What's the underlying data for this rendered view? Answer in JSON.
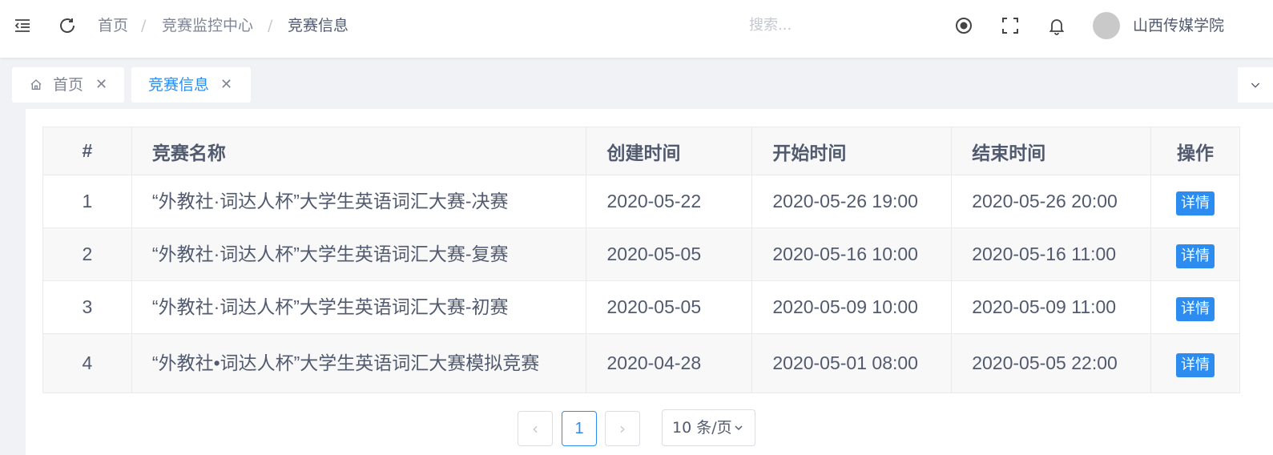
{
  "header": {
    "breadcrumb": [
      "首页",
      "竞赛监控中心",
      "竞赛信息"
    ],
    "breadcrumb_sep": "/",
    "search_placeholder": "搜索...",
    "user_name": "山西传媒学院"
  },
  "tabs": [
    {
      "label": "首页",
      "active": false
    },
    {
      "label": "竞赛信息",
      "active": true
    }
  ],
  "table": {
    "headers": [
      "#",
      "竞赛名称",
      "创建时间",
      "开始时间",
      "结束时间",
      "操作"
    ],
    "rows": [
      {
        "index": "1",
        "name": "“外教社·词达人杯”大学生英语词汇大赛-决赛",
        "created": "2020-05-22",
        "start": "2020-05-26 19:00",
        "end": "2020-05-26 20:00",
        "action": "详情"
      },
      {
        "index": "2",
        "name": "“外教社·词达人杯”大学生英语词汇大赛-复赛",
        "created": "2020-05-05",
        "start": "2020-05-16 10:00",
        "end": "2020-05-16 11:00",
        "action": "详情"
      },
      {
        "index": "3",
        "name": "“外教社·词达人杯”大学生英语词汇大赛-初赛",
        "created": "2020-05-05",
        "start": "2020-05-09 10:00",
        "end": "2020-05-09 11:00",
        "action": "详情"
      },
      {
        "index": "4",
        "name": "“外教社•词达人杯”大学生英语词汇大赛模拟竞赛",
        "created": "2020-04-28",
        "start": "2020-05-01 08:00",
        "end": "2020-05-05 22:00",
        "action": "详情"
      }
    ]
  },
  "pagination": {
    "prev": "‹",
    "current_page": "1",
    "next": "›",
    "page_size": "10 条/页"
  },
  "colors": {
    "accent": "#2d8cf0",
    "header_bg": "#f8f8f9",
    "border": "#dcdee2"
  }
}
